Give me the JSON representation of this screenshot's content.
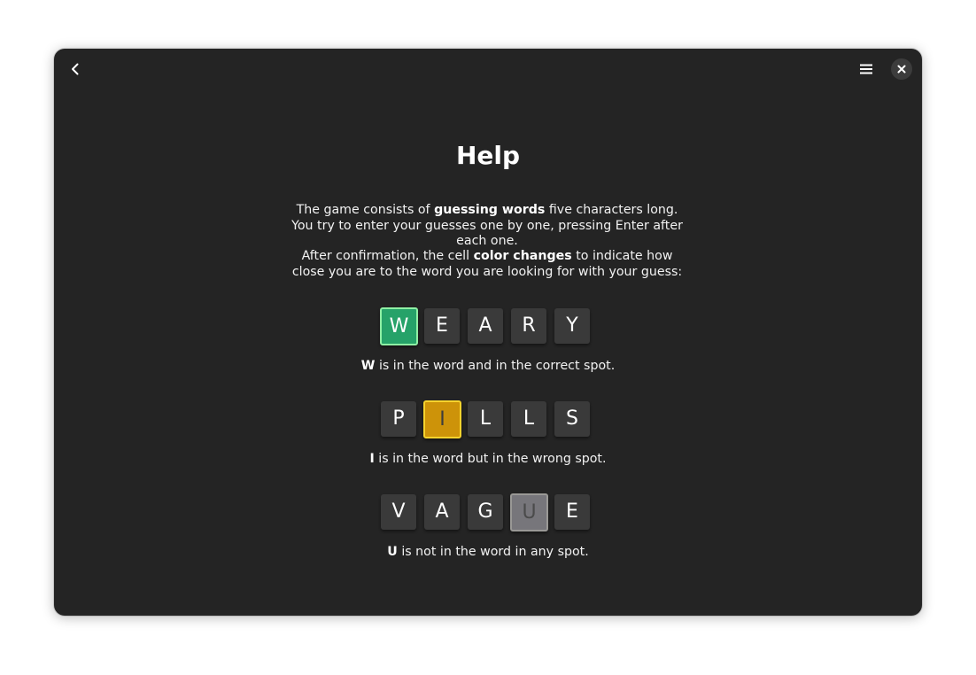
{
  "header": {
    "back_icon": "chevron-left-icon",
    "menu_icon": "hamburger-menu-icon",
    "close_icon": "close-icon"
  },
  "help": {
    "title": "Help",
    "paragraph1": {
      "before": "The game consists of ",
      "bold": "guessing words",
      "after": " five characters long. You try to enter your guesses one by one, pressing Enter after each one."
    },
    "paragraph2": {
      "before": "After confirmation, the cell ",
      "bold": "color changes",
      "after": " to indicate how close you are to the word you are looking for with your guess:"
    }
  },
  "examples": [
    {
      "letters": [
        "W",
        "E",
        "A",
        "R",
        "Y"
      ],
      "highlight_index": 0,
      "state": "correct",
      "caption_letter": "W",
      "caption_text": " is in the word and in the correct spot."
    },
    {
      "letters": [
        "P",
        "I",
        "L",
        "L",
        "S"
      ],
      "highlight_index": 1,
      "state": "present",
      "caption_letter": "I",
      "caption_text": " is in the word but in the wrong spot."
    },
    {
      "letters": [
        "V",
        "A",
        "G",
        "U",
        "E"
      ],
      "highlight_index": 3,
      "state": "absent",
      "caption_letter": "U",
      "caption_text": " is not in the word in any spot."
    }
  ],
  "colors": {
    "window_bg": "#242424",
    "tile_bg": "#3a3a3a",
    "correct": "#26a269",
    "present": "#cd9309",
    "absent": "#77767b"
  }
}
